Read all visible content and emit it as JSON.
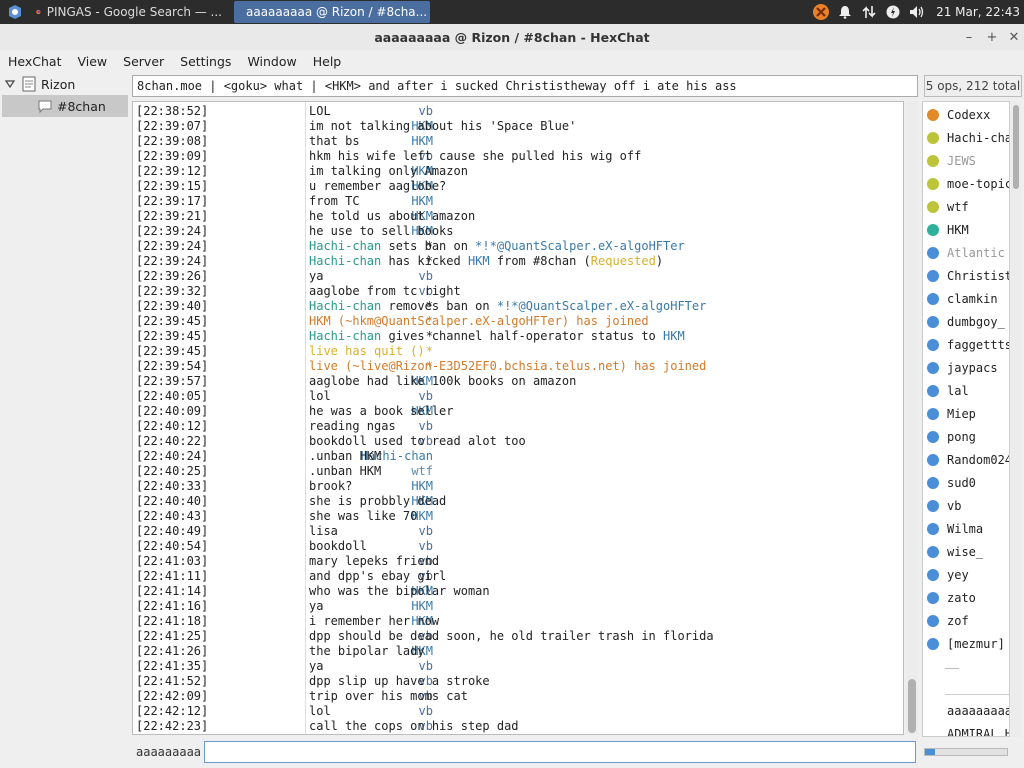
{
  "panel": {
    "tasks": [
      {
        "label": "PINGAS - Google Search — ...",
        "icon": "firefox-icon"
      },
      {
        "label": "aaaaaaaaa @ Rizon / #8cha...",
        "icon": "hexchat-icon"
      }
    ],
    "clock": "21 Mar, 22:43"
  },
  "window": {
    "title": "aaaaaaaaa @ Rizon / #8chan - HexChat"
  },
  "menu": [
    "HexChat",
    "View",
    "Server",
    "Settings",
    "Window",
    "Help"
  ],
  "tree": {
    "network": "Rizon",
    "channel": "#8chan"
  },
  "topic": "8chan.moe | <goku> what | <HKM> and after i sucked Christistheway off i ate his ass",
  "user_count": "5 ops, 212 total",
  "chat": [
    {
      "ts": "[22:38:52]",
      "nick": "vb",
      "nc": "c-vb",
      "msg": "LOL"
    },
    {
      "ts": "[22:39:07]",
      "nick": "HKM",
      "nc": "c-hkm",
      "msg": "im not talking about his 'Space Blue'"
    },
    {
      "ts": "[22:39:08]",
      "nick": "HKM",
      "nc": "c-hkm",
      "msg": "that bs"
    },
    {
      "ts": "[22:39:09]",
      "nick": "vb",
      "nc": "c-vb",
      "msg": "hkm his wife left cause she pulled his wig off"
    },
    {
      "ts": "[22:39:12]",
      "nick": "HKM",
      "nc": "c-hkm",
      "msg": "im talking only Amazon"
    },
    {
      "ts": "[22:39:15]",
      "nick": "HKM",
      "nc": "c-hkm",
      "msg": "u remember aaglobe?"
    },
    {
      "ts": "[22:39:17]",
      "nick": "HKM",
      "nc": "c-hkm",
      "msg": "from TC"
    },
    {
      "ts": "[22:39:21]",
      "nick": "HKM",
      "nc": "c-hkm",
      "msg": "he told us about amazon"
    },
    {
      "ts": "[22:39:24]",
      "nick": "HKM",
      "nc": "c-hkm",
      "msg": "he use to sell books"
    },
    {
      "ts": "[22:39:24]",
      "nick": "*",
      "nc": "",
      "parts": [
        [
          "Hachi-chan",
          "c-hachi"
        ],
        [
          " sets ban on ",
          ""
        ],
        [
          "*!*@QuantScalper.eX-algoHFTer",
          "c-ban"
        ]
      ]
    },
    {
      "ts": "[22:39:24]",
      "nick": "*",
      "nc": "",
      "parts": [
        [
          "Hachi-chan",
          "c-hachi"
        ],
        [
          " has kicked ",
          ""
        ],
        [
          "HKM",
          "c-hkm"
        ],
        [
          " from #8chan (",
          ""
        ],
        [
          "Requested",
          "c-req"
        ],
        [
          ")",
          ""
        ]
      ]
    },
    {
      "ts": "[22:39:26]",
      "nick": "vb",
      "nc": "c-vb",
      "msg": "ya"
    },
    {
      "ts": "[22:39:32]",
      "nick": "vb",
      "nc": "c-vb",
      "msg": "aaglobe from tc right"
    },
    {
      "ts": "[22:39:40]",
      "nick": "*",
      "nc": "",
      "parts": [
        [
          "Hachi-chan",
          "c-hachi"
        ],
        [
          " removes ban on ",
          ""
        ],
        [
          "*!*@QuantScalper.eX-algoHFTer",
          "c-ban"
        ]
      ]
    },
    {
      "ts": "[22:39:45]",
      "nick": "*",
      "nc": "c-join",
      "parts": [
        [
          "HKM (~hkm@QuantScalper.eX-algoHFTer) has joined",
          "c-join"
        ]
      ]
    },
    {
      "ts": "[22:39:45]",
      "nick": "*",
      "nc": "",
      "parts": [
        [
          "Hachi-chan",
          "c-hachi"
        ],
        [
          " gives channel half-operator status to ",
          ""
        ],
        [
          "HKM",
          "c-hkm"
        ]
      ]
    },
    {
      "ts": "[22:39:45]",
      "nick": "*",
      "nc": "c-quit",
      "parts": [
        [
          "live has quit ()",
          "c-quit"
        ]
      ]
    },
    {
      "ts": "[22:39:54]",
      "nick": "*",
      "nc": "c-join",
      "parts": [
        [
          "live (~live@Rizon-E3D52EF0.bchsia.telus.net) has joined",
          "c-join"
        ]
      ]
    },
    {
      "ts": "[22:39:57]",
      "nick": "HKM",
      "nc": "c-hkm",
      "msg": "aaglobe had like 100k books on amazon"
    },
    {
      "ts": "[22:40:05]",
      "nick": "vb",
      "nc": "c-vb",
      "msg": "lol"
    },
    {
      "ts": "[22:40:09]",
      "nick": "HKM",
      "nc": "c-hkm",
      "msg": "he was a book seller"
    },
    {
      "ts": "[22:40:12]",
      "nick": "vb",
      "nc": "c-vb",
      "msg": "reading ngas"
    },
    {
      "ts": "[22:40:22]",
      "nick": "vb",
      "nc": "c-vb",
      "msg": "bookdoll used to read alot too"
    },
    {
      "ts": "[22:40:24]",
      "nick": "Hachi-chan",
      "nc": "c-hkm",
      "msg": ".unban HKM"
    },
    {
      "ts": "[22:40:25]",
      "nick": "wtf",
      "nc": "c-wtf",
      "msg": ".unban HKM"
    },
    {
      "ts": "[22:40:33]",
      "nick": "HKM",
      "nc": "c-hkm",
      "msg": "brook?"
    },
    {
      "ts": "[22:40:40]",
      "nick": "HKM",
      "nc": "c-hkm",
      "msg": "she is probbly dead"
    },
    {
      "ts": "[22:40:43]",
      "nick": "HKM",
      "nc": "c-hkm",
      "msg": "she was like 70"
    },
    {
      "ts": "[22:40:49]",
      "nick": "vb",
      "nc": "c-vb",
      "msg": "lisa"
    },
    {
      "ts": "[22:40:54]",
      "nick": "vb",
      "nc": "c-vb",
      "msg": "bookdoll"
    },
    {
      "ts": "[22:41:03]",
      "nick": "vb",
      "nc": "c-vb",
      "msg": "mary lepeks friend"
    },
    {
      "ts": "[22:41:11]",
      "nick": "vb",
      "nc": "c-vb",
      "msg": "and dpp's ebay girl"
    },
    {
      "ts": "[22:41:14]",
      "nick": "HKM",
      "nc": "c-hkm",
      "msg": "who was the bipolar woman"
    },
    {
      "ts": "[22:41:16]",
      "nick": "HKM",
      "nc": "c-hkm",
      "msg": "ya"
    },
    {
      "ts": "[22:41:18]",
      "nick": "HKM",
      "nc": "c-hkm",
      "msg": "i remember her now"
    },
    {
      "ts": "[22:41:25]",
      "nick": "vb",
      "nc": "c-vb",
      "msg": "dpp should be dead soon, he old trailer trash in florida"
    },
    {
      "ts": "[22:41:26]",
      "nick": "HKM",
      "nc": "c-hkm",
      "msg": "the bipolar lady"
    },
    {
      "ts": "[22:41:35]",
      "nick": "vb",
      "nc": "c-vb",
      "msg": "ya"
    },
    {
      "ts": "[22:41:52]",
      "nick": "vb",
      "nc": "c-vb",
      "msg": "dpp slip up have a stroke"
    },
    {
      "ts": "[22:42:09]",
      "nick": "vb",
      "nc": "c-vb",
      "msg": "trip over his moms cat"
    },
    {
      "ts": "[22:42:12]",
      "nick": "vb",
      "nc": "c-vb",
      "msg": "lol"
    },
    {
      "ts": "[22:42:23]",
      "nick": "vb",
      "nc": "c-vb",
      "msg": "call the cops on his step dad"
    }
  ],
  "users": [
    {
      "name": "Codexx",
      "color": "#e08a2a",
      "text": "#222"
    },
    {
      "name": "Hachi-cha",
      "color": "#bcc43a",
      "text": "#222"
    },
    {
      "name": "JEWS",
      "color": "#bcc43a",
      "text": "#999"
    },
    {
      "name": "moe-topic",
      "color": "#bcc43a",
      "text": "#222"
    },
    {
      "name": "wtf",
      "color": "#bcc43a",
      "text": "#222"
    },
    {
      "name": "HKM",
      "color": "#2fb09a",
      "text": "#222"
    },
    {
      "name": "Atlantic",
      "color": "#4b8ed8",
      "text": "#999"
    },
    {
      "name": "Christist",
      "color": "#4b8ed8",
      "text": "#222"
    },
    {
      "name": "clamkin",
      "color": "#4b8ed8",
      "text": "#222"
    },
    {
      "name": "dumbgoy_",
      "color": "#4b8ed8",
      "text": "#222"
    },
    {
      "name": "faggettts",
      "color": "#4b8ed8",
      "text": "#222"
    },
    {
      "name": "jaypacs",
      "color": "#4b8ed8",
      "text": "#222"
    },
    {
      "name": "lal",
      "color": "#4b8ed8",
      "text": "#222"
    },
    {
      "name": "Miep",
      "color": "#4b8ed8",
      "text": "#222"
    },
    {
      "name": "pong",
      "color": "#4b8ed8",
      "text": "#222"
    },
    {
      "name": "Random024",
      "color": "#4b8ed8",
      "text": "#222"
    },
    {
      "name": "sud0",
      "color": "#4b8ed8",
      "text": "#222"
    },
    {
      "name": "vb",
      "color": "#4b8ed8",
      "text": "#222"
    },
    {
      "name": "Wilma",
      "color": "#4b8ed8",
      "text": "#222"
    },
    {
      "name": "wise_",
      "color": "#4b8ed8",
      "text": "#222"
    },
    {
      "name": "yey",
      "color": "#4b8ed8",
      "text": "#222"
    },
    {
      "name": "zato",
      "color": "#4b8ed8",
      "text": "#222"
    },
    {
      "name": "zof",
      "color": "#4b8ed8",
      "text": "#222"
    },
    {
      "name": "[mezmur]",
      "color": "#4b8ed8",
      "text": "#222"
    }
  ],
  "button_labels": [
    "aaaaaaaaa",
    "ADMIRAL_H"
  ],
  "input": {
    "nick": "aaaaaaaaa",
    "value": ""
  }
}
